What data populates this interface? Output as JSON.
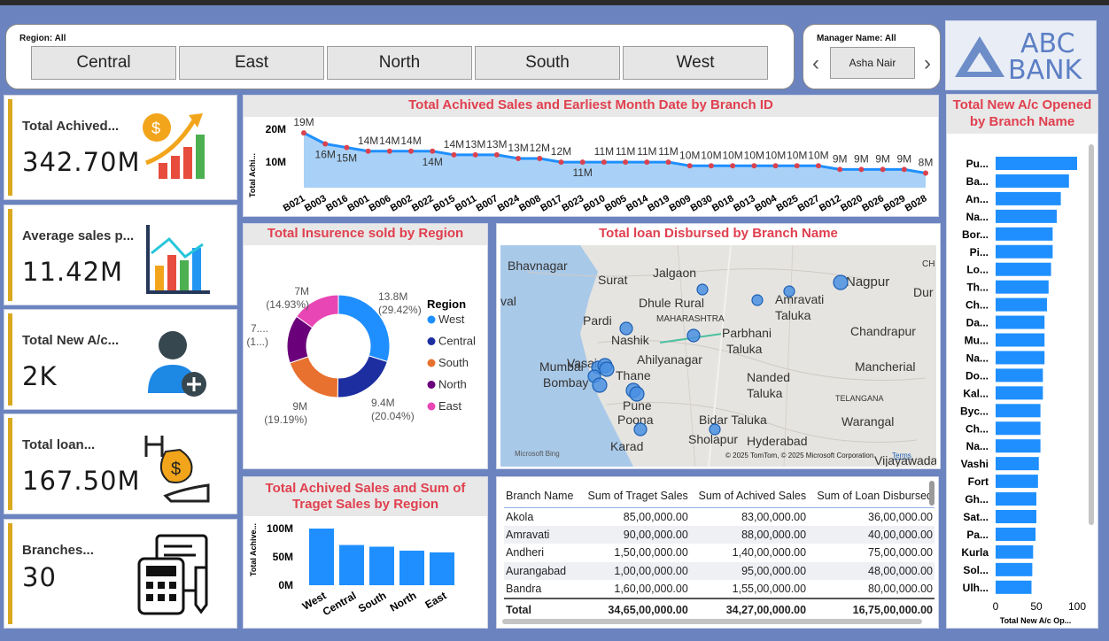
{
  "region_slicer": {
    "label": "Region: All",
    "options": [
      "Central",
      "East",
      "North",
      "South",
      "West"
    ]
  },
  "manager_slicer": {
    "label": "Manager Name: All",
    "value": "Asha Nair",
    "prev": "‹",
    "next": "›"
  },
  "logo": {
    "line1": "ABC",
    "line2": "BANK",
    "color": "#4f7cc4"
  },
  "kpis": [
    {
      "title": "Total Achived...",
      "value": "342.70M"
    },
    {
      "title": "Average sales p...",
      "value": "11.42M"
    },
    {
      "title": "Total New A/c...",
      "value": "2K"
    },
    {
      "title": "Total loan...",
      "value": "167.50M"
    },
    {
      "title": "Branches...",
      "value": "30"
    }
  ],
  "accent_color": "#d9a81e",
  "title_color": "#e0404f",
  "line_chart": {
    "title": "Total Achived Sales and Earliest Month Date by Branch ID",
    "ylabel": "Total Achi...",
    "yticks": [
      "20M",
      "10M"
    ],
    "chart_data": {
      "type": "line",
      "x": [
        "B021",
        "B003",
        "B016",
        "B001",
        "B006",
        "B002",
        "B022",
        "B015",
        "B011",
        "B007",
        "B024",
        "B008",
        "B017",
        "B023",
        "B010",
        "B005",
        "B014",
        "B019",
        "B009",
        "B030",
        "B018",
        "B013",
        "B004",
        "B025",
        "B027",
        "B012",
        "B020",
        "B026",
        "B029",
        "B028"
      ],
      "values": [
        19,
        16,
        15,
        14,
        14,
        14,
        14,
        13,
        13,
        13,
        12,
        12,
        11,
        11,
        11,
        11,
        11,
        11,
        10,
        10,
        10,
        10,
        10,
        10,
        10,
        9,
        9,
        9,
        9,
        8
      ],
      "labels": [
        "19M",
        "16M",
        "15M",
        "14M",
        "14M",
        "14M",
        "14M",
        "14M",
        "13M",
        "13M",
        "13M",
        "12M",
        "12M",
        "11M",
        "11M",
        "11M",
        "11M",
        "11M",
        "10M",
        "10M",
        "10M",
        "10M",
        "10M",
        "10M",
        "10M",
        "9M",
        "9M",
        "9M",
        "9M",
        "8M"
      ],
      "ylim": [
        0,
        20
      ],
      "color": "#1f8fff"
    }
  },
  "donut": {
    "title": "Total Insurence sold by Region",
    "legend_title": "Region",
    "chart_data": {
      "type": "pie",
      "categories": [
        "West",
        "Central",
        "South",
        "North",
        "East"
      ],
      "values": [
        13.8,
        9.4,
        9,
        7,
        7
      ],
      "percents": [
        "(29.42%)",
        "(20.04%)",
        "(19.19%)",
        "(1...)",
        "(14.93%)"
      ],
      "value_labels": [
        "13.8M",
        "9.4M",
        "9M",
        "7....",
        "7M"
      ],
      "colors": [
        "#1f8fff",
        "#1c2ea0",
        "#e8712f",
        "#6b007b",
        "#e846b4"
      ]
    }
  },
  "map": {
    "title": "Total loan Disbursed by Branch Name",
    "places": [
      "Bhavnagar",
      "Surat",
      "Jalgaon",
      "Nagpur",
      "Dhule Rural",
      "Amravati",
      "Taluka",
      "Pardi",
      "MAHARASHTRA",
      "Nashik",
      "Parbhani",
      "Chandrapur",
      "Vasai",
      "Taluka",
      "Ahilyanagar",
      "Mumbai",
      "Thane",
      "Bombay",
      "Mancherial",
      "Nanded",
      "Taluka",
      "Pune",
      "TELANGANA",
      "Warangal",
      "Poona",
      "Bidar Taluka",
      "Sholapur",
      "Hyderabad",
      "Karad",
      "Vijayawada",
      "CH",
      "Dur",
      "val"
    ],
    "attribution": "© 2025 TomTom, © 2025 Microsoft Corporation",
    "terms": "Terms",
    "bing": "Microsoft Bing"
  },
  "region_bar": {
    "title_line1": "Total Achived Sales and Sum of",
    "title_line2": "Traget Sales by Region",
    "ylabel": "Total Achive...",
    "yticks": [
      "100M",
      "50M",
      "0M"
    ],
    "chart_data": {
      "type": "bar",
      "categories": [
        "West",
        "Central",
        "South",
        "North",
        "East"
      ],
      "values": [
        100,
        71,
        68,
        61,
        58
      ],
      "ylim": [
        0,
        100
      ],
      "color": "#1f8fff"
    }
  },
  "table": {
    "columns": [
      "Branch Name",
      "Sum of Traget Sales",
      "Sum of Achived Sales",
      "Sum of Loan Disbursed"
    ],
    "rows": [
      [
        "Akola",
        "85,00,000.00",
        "83,00,000.00",
        "36,00,000.00"
      ],
      [
        "Amravati",
        "90,00,000.00",
        "88,00,000.00",
        "40,00,000.00"
      ],
      [
        "Andheri",
        "1,50,00,000.00",
        "1,40,00,000.00",
        "75,00,000.00"
      ],
      [
        "Aurangabad",
        "1,00,00,000.00",
        "95,00,000.00",
        "48,00,000.00"
      ],
      [
        "Bandra",
        "1,60,00,000.00",
        "1,55,00,000.00",
        "80,00,000.00"
      ]
    ],
    "total": [
      "Total",
      "34,65,00,000.00",
      "34,27,00,000.00",
      "16,75,00,000.00"
    ]
  },
  "hbar": {
    "title_line1": "Total New A/c Opened",
    "title_line2": "by Branch Name",
    "xlabel": "Total New A/c Op...",
    "xticks": [
      "0",
      "50",
      "100"
    ],
    "chart_data": {
      "type": "bar",
      "categories": [
        "Pu...",
        "Ba...",
        "An...",
        "Na...",
        "Bor...",
        "Pi...",
        "Lo...",
        "Th...",
        "Ch...",
        "Da...",
        "Mu...",
        "Na...",
        "Do...",
        "Kal...",
        "Byc...",
        "Ch...",
        "Na...",
        "Vashi",
        "Fort",
        "Gh...",
        "Sat...",
        "Pa...",
        "Kurla",
        "Sol...",
        "Ulh..."
      ],
      "values": [
        100,
        90,
        80,
        75,
        70,
        70,
        68,
        65,
        63,
        60,
        60,
        60,
        58,
        58,
        55,
        55,
        55,
        53,
        52,
        50,
        50,
        49,
        46,
        45,
        44
      ],
      "xlim": [
        0,
        100
      ],
      "color": "#1f8fff"
    }
  }
}
